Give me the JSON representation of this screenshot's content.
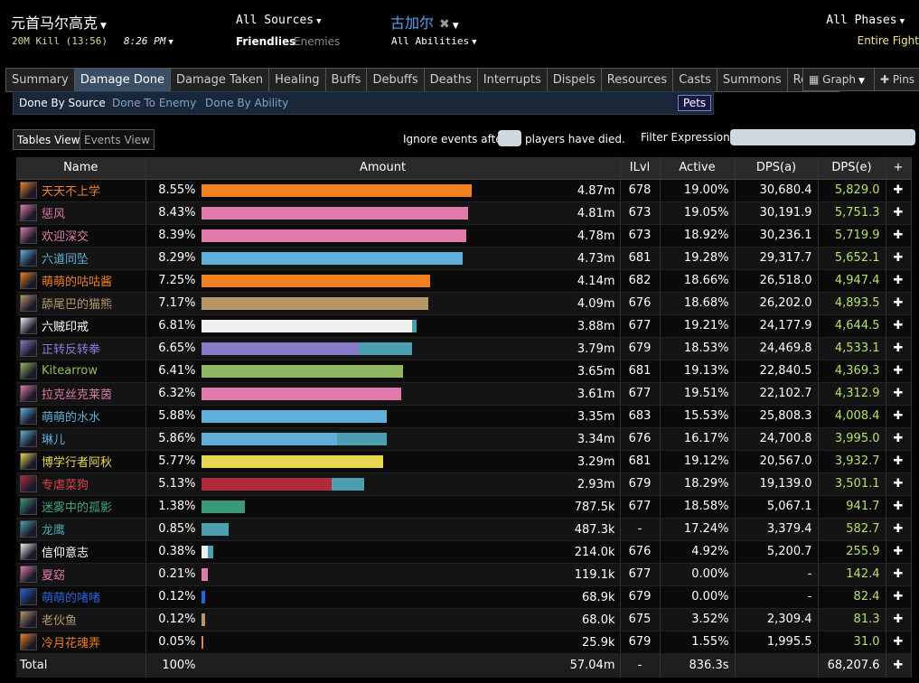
{
  "header": {
    "boss": "元首马尔高克",
    "kill": "20M Kill (13:56)",
    "time": "8:26 PM",
    "sources": "All Sources",
    "friendlies": "Friendlies",
    "enemies": "Enemies",
    "target": "古加尔",
    "abilities": "All Abilities",
    "phases": "All Phases",
    "fight": "Entire Fight"
  },
  "tabs": [
    "Summary",
    "Damage Done",
    "Damage Taken",
    "Healing",
    "Buffs",
    "Debuffs",
    "Deaths",
    "Interrupts",
    "Dispels",
    "Resources",
    "Casts",
    "Summons",
    "Replay"
  ],
  "graph_label": "Graph",
  "pins_label": "Pins",
  "subtabs": [
    "Done By Source",
    "Done To Enemy",
    "Done By Ability"
  ],
  "pets_label": "Pets",
  "views": [
    "Tables View",
    "Events View"
  ],
  "ignore_prefix": "Ignore events after",
  "ignore_suffix": "players have died.",
  "filter_label": "Filter Expression:",
  "columns": {
    "name": "Name",
    "amount": "Amount",
    "ilvl": "ILvl",
    "active": "Active",
    "dpsa": "DPS(a)",
    "dpse": "DPS(e)",
    "plus": "+"
  },
  "colors": {
    "mage": "#f08020",
    "paladin": "#e07aa8",
    "dk": "#5fb0d8",
    "warrior": "#b8966a",
    "priest": "#f0f0f0",
    "monk": "#8a78c8",
    "hunter": "#90b860",
    "rogue": "#e8d850",
    "pet": "#4aa0b0",
    "warlock_dark": "#b02a3a",
    "shaman": "#2a60d8",
    "tank": "#3a9878"
  },
  "rows": [
    {
      "icon": "frost-mage-icon",
      "name": "天天不上学",
      "color": "#f08020",
      "pct": "8.55%",
      "frac": 0.75,
      "frac2": 0,
      "c1": "#f08020",
      "c2": "",
      "amt": "4.87m",
      "ilvl": "678",
      "active": "19.00%",
      "dpsa": "30,680.4",
      "dpse": "5,829.0"
    },
    {
      "icon": "retribution-icon",
      "name": "惩风",
      "color": "#e07aa8",
      "pct": "8.43%",
      "frac": 0.74,
      "frac2": 0,
      "c1": "#e07aa8",
      "c2": "",
      "amt": "4.81m",
      "ilvl": "673",
      "active": "19.05%",
      "dpsa": "30,191.9",
      "dpse": "5,751.3"
    },
    {
      "icon": "retribution-icon",
      "name": "欢迎深交",
      "color": "#e07aa8",
      "pct": "8.39%",
      "frac": 0.735,
      "frac2": 0,
      "c1": "#e07aa8",
      "c2": "",
      "amt": "4.78m",
      "ilvl": "673",
      "active": "18.92%",
      "dpsa": "30,236.1",
      "dpse": "5,719.9"
    },
    {
      "icon": "frost-dk-icon",
      "name": "六道同坠",
      "color": "#5fb0d8",
      "pct": "8.29%",
      "frac": 0.725,
      "frac2": 0,
      "c1": "#5fb0d8",
      "c2": "",
      "amt": "4.73m",
      "ilvl": "681",
      "active": "19.28%",
      "dpsa": "29,317.7",
      "dpse": "5,652.1"
    },
    {
      "icon": "fire-mage-icon",
      "name": "萌萌的咕咕酱",
      "color": "#f08020",
      "pct": "7.25%",
      "frac": 0.635,
      "frac2": 0,
      "c1": "#f08020",
      "c2": "",
      "amt": "4.14m",
      "ilvl": "682",
      "active": "18.66%",
      "dpsa": "26,518.0",
      "dpse": "4,947.4"
    },
    {
      "icon": "arms-warrior-icon",
      "name": "舔尾巴的猫熊",
      "color": "#b8966a",
      "pct": "7.17%",
      "frac": 0.628,
      "frac2": 0,
      "c1": "#b8966a",
      "c2": "",
      "amt": "4.09m",
      "ilvl": "676",
      "active": "18.68%",
      "dpsa": "26,202.0",
      "dpse": "4,893.5"
    },
    {
      "icon": "shadow-priest-icon",
      "name": "六贼印戒",
      "color": "#ffffff",
      "pct": "6.81%",
      "frac": 0.585,
      "frac2": 0.012,
      "c1": "#f0f0f0",
      "c2": "#4aa0b0",
      "amt": "3.88m",
      "ilvl": "677",
      "active": "19.21%",
      "dpsa": "24,177.9",
      "dpse": "4,644.5"
    },
    {
      "icon": "windwalker-icon",
      "name": "正转反转拳",
      "color": "#8a7ae0",
      "pct": "6.65%",
      "frac": 0.435,
      "frac2": 0.148,
      "c1": "#8a78c8",
      "c2": "#4aa0b0",
      "amt": "3.79m",
      "ilvl": "679",
      "active": "18.53%",
      "dpsa": "24,469.8",
      "dpse": "4,533.1"
    },
    {
      "icon": "hunter-icon",
      "name": "Kitearrow",
      "color": "#90c050",
      "pct": "6.41%",
      "frac": 0.56,
      "frac2": 0,
      "c1": "#90b860",
      "c2": "",
      "amt": "3.65m",
      "ilvl": "681",
      "active": "19.13%",
      "dpsa": "22,840.5",
      "dpse": "4,369.3"
    },
    {
      "icon": "retribution-icon",
      "name": "拉克丝克莱茵",
      "color": "#e07aa8",
      "pct": "6.32%",
      "frac": 0.553,
      "frac2": 0,
      "c1": "#e07aa8",
      "c2": "",
      "amt": "3.61m",
      "ilvl": "677",
      "active": "19.51%",
      "dpsa": "22,102.7",
      "dpse": "4,312.9"
    },
    {
      "icon": "frost-mage-icon",
      "name": "萌萌的水水",
      "color": "#5fb0d8",
      "pct": "5.88%",
      "frac": 0.515,
      "frac2": 0,
      "c1": "#5fb0d8",
      "c2": "",
      "amt": "3.35m",
      "ilvl": "683",
      "active": "15.53%",
      "dpsa": "25,808.3",
      "dpse": "4,008.4"
    },
    {
      "icon": "frost-mage-icon",
      "name": "琳儿",
      "color": "#5fb0d8",
      "pct": "5.86%",
      "frac": 0.375,
      "frac2": 0.138,
      "c1": "#5fb0d8",
      "c2": "#4aa0b0",
      "amt": "3.34m",
      "ilvl": "676",
      "active": "16.17%",
      "dpsa": "24,700.8",
      "dpse": "3,995.0"
    },
    {
      "icon": "combat-rogue-icon",
      "name": "博学行者阿秋",
      "color": "#e8d850",
      "pct": "5.77%",
      "frac": 0.505,
      "frac2": 0,
      "c1": "#e8d850",
      "c2": "",
      "amt": "3.29m",
      "ilvl": "681",
      "active": "19.12%",
      "dpsa": "20,567.0",
      "dpse": "3,932.7"
    },
    {
      "icon": "affliction-icon",
      "name": "专虐菜狗",
      "color": "#e04050",
      "pct": "5.13%",
      "frac": 0.36,
      "frac2": 0.09,
      "c1": "#b02a3a",
      "c2": "#4aa0b0",
      "amt": "2.93m",
      "ilvl": "679",
      "active": "18.29%",
      "dpsa": "19,139.0",
      "dpse": "3,501.1"
    },
    {
      "icon": "tank-monk-icon",
      "name": "迷雾中的孤影",
      "color": "#3aa888",
      "pct": "1.38%",
      "frac": 0.12,
      "frac2": 0,
      "c1": "#3a9878",
      "c2": "",
      "amt": "787.5k",
      "ilvl": "677",
      "active": "18.58%",
      "dpsa": "5,067.1",
      "dpse": "941.7"
    },
    {
      "icon": "pet-icon",
      "name": "龙鹰",
      "color": "#4aa0b0",
      "pct": "0.85%",
      "frac": 0.074,
      "frac2": 0,
      "c1": "#4aa0b0",
      "c2": "",
      "amt": "487.3k",
      "ilvl": "-",
      "active": "17.24%",
      "dpsa": "3,379.4",
      "dpse": "582.7"
    },
    {
      "icon": "holy-priest-icon",
      "name": "信仰意志",
      "color": "#ffffff",
      "pct": "0.38%",
      "frac": 0.018,
      "frac2": 0.015,
      "c1": "#f0f0f0",
      "c2": "#4aa0b0",
      "amt": "214.0k",
      "ilvl": "676",
      "active": "4.92%",
      "dpsa": "5,200.7",
      "dpse": "255.9"
    },
    {
      "icon": "holy-paladin-icon",
      "name": "夏窈",
      "color": "#e07aa8",
      "pct": "0.21%",
      "frac": 0.018,
      "frac2": 0,
      "c1": "#e07aa8",
      "c2": "",
      "amt": "119.1k",
      "ilvl": "677",
      "active": "0.00%",
      "dpsa": "-",
      "dpse": "142.4"
    },
    {
      "icon": "resto-shaman-icon",
      "name": "萌萌的啫啫",
      "color": "#2a60d8",
      "pct": "0.12%",
      "frac": 0.011,
      "frac2": 0,
      "c1": "#2a60d8",
      "c2": "",
      "amt": "68.9k",
      "ilvl": "679",
      "active": "0.00%",
      "dpsa": "-",
      "dpse": "82.4"
    },
    {
      "icon": "prot-warrior-icon",
      "name": "老伙鱼",
      "color": "#b8966a",
      "pct": "0.12%",
      "frac": 0.011,
      "frac2": 0,
      "c1": "#b8966a",
      "c2": "",
      "amt": "68.0k",
      "ilvl": "675",
      "active": "3.52%",
      "dpsa": "2,309.4",
      "dpse": "81.3"
    },
    {
      "icon": "mistweaver-icon",
      "name": "冷月花魂弄",
      "color": "#f08020",
      "pct": "0.05%",
      "frac": 0.004,
      "frac2": 0,
      "c1": "#f08020",
      "c2": "",
      "amt": "25.9k",
      "ilvl": "679",
      "active": "1.55%",
      "dpsa": "1,995.5",
      "dpse": "31.0"
    }
  ],
  "total": {
    "label": "Total",
    "pct": "100%",
    "amt": "57.04m",
    "ilvl": "-",
    "active": "836.3s",
    "dpsa": "",
    "dpse": "68,207.6"
  }
}
